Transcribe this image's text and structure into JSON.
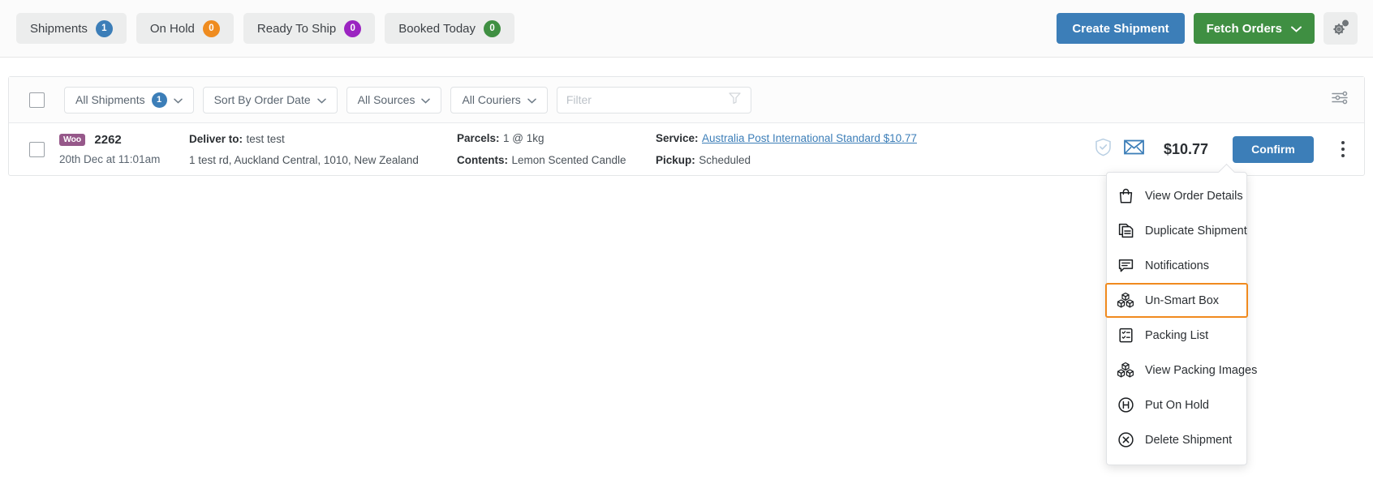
{
  "topbar": {
    "tabs": [
      {
        "label": "Shipments",
        "count": "1",
        "color": "#3c7eb8"
      },
      {
        "label": "On Hold",
        "count": "0",
        "color": "#ef8c20"
      },
      {
        "label": "Ready To Ship",
        "count": "0",
        "color": "#9b24c1"
      },
      {
        "label": "Booked Today",
        "count": "0",
        "color": "#3f8f42"
      }
    ],
    "create_shipment_label": "Create Shipment",
    "fetch_orders_label": "Fetch Orders",
    "settings_icon": "gears-icon"
  },
  "filterbar": {
    "all_shipments_label": "All Shipments",
    "all_shipments_count": "1",
    "sort_label": "Sort By Order Date",
    "sources_label": "All Sources",
    "couriers_label": "All Couriers",
    "filter_placeholder": "Filter",
    "filter_value": "",
    "funnel_icon": "funnel-icon",
    "sliders_icon": "sliders-icon"
  },
  "shipment": {
    "source_badge": "Woo",
    "order_number": "2262",
    "order_date": "20th Dec at 11:01am",
    "deliver_to_label": "Deliver to:",
    "deliver_to_name": "test test",
    "address": "1 test rd, Auckland Central, 1010, New Zealand",
    "parcels_label": "Parcels:",
    "parcels_value": "1 @ 1kg",
    "contents_label": "Contents:",
    "contents_value": "Lemon Scented Candle",
    "service_label": "Service:",
    "service_link": "Australia Post International Standard $10.77",
    "pickup_label": "Pickup:",
    "pickup_value": "Scheduled",
    "shield_icon": "shield-check-icon",
    "envelope_icon": "envelope-icon",
    "price": "$10.77",
    "confirm_label": "Confirm",
    "kebab_icon": "kebab-menu-icon"
  },
  "context_menu": {
    "highlight_color": "#f08a1e",
    "items": [
      {
        "label": "View Order Details",
        "icon": "shopping-bag-icon",
        "highlighted": false
      },
      {
        "label": "Duplicate Shipment",
        "icon": "duplicate-doc-icon",
        "highlighted": false
      },
      {
        "label": "Notifications",
        "icon": "chat-bubble-icon",
        "highlighted": false
      },
      {
        "label": "Un-Smart Box",
        "icon": "boxes-icon",
        "highlighted": true
      },
      {
        "label": "Packing List",
        "icon": "checklist-icon",
        "highlighted": false
      },
      {
        "label": "View Packing Images",
        "icon": "boxes-icon",
        "highlighted": false
      },
      {
        "label": "Put On Hold",
        "icon": "hold-circle-icon",
        "highlighted": false
      },
      {
        "label": "Delete Shipment",
        "icon": "delete-circle-icon",
        "highlighted": false
      }
    ]
  }
}
